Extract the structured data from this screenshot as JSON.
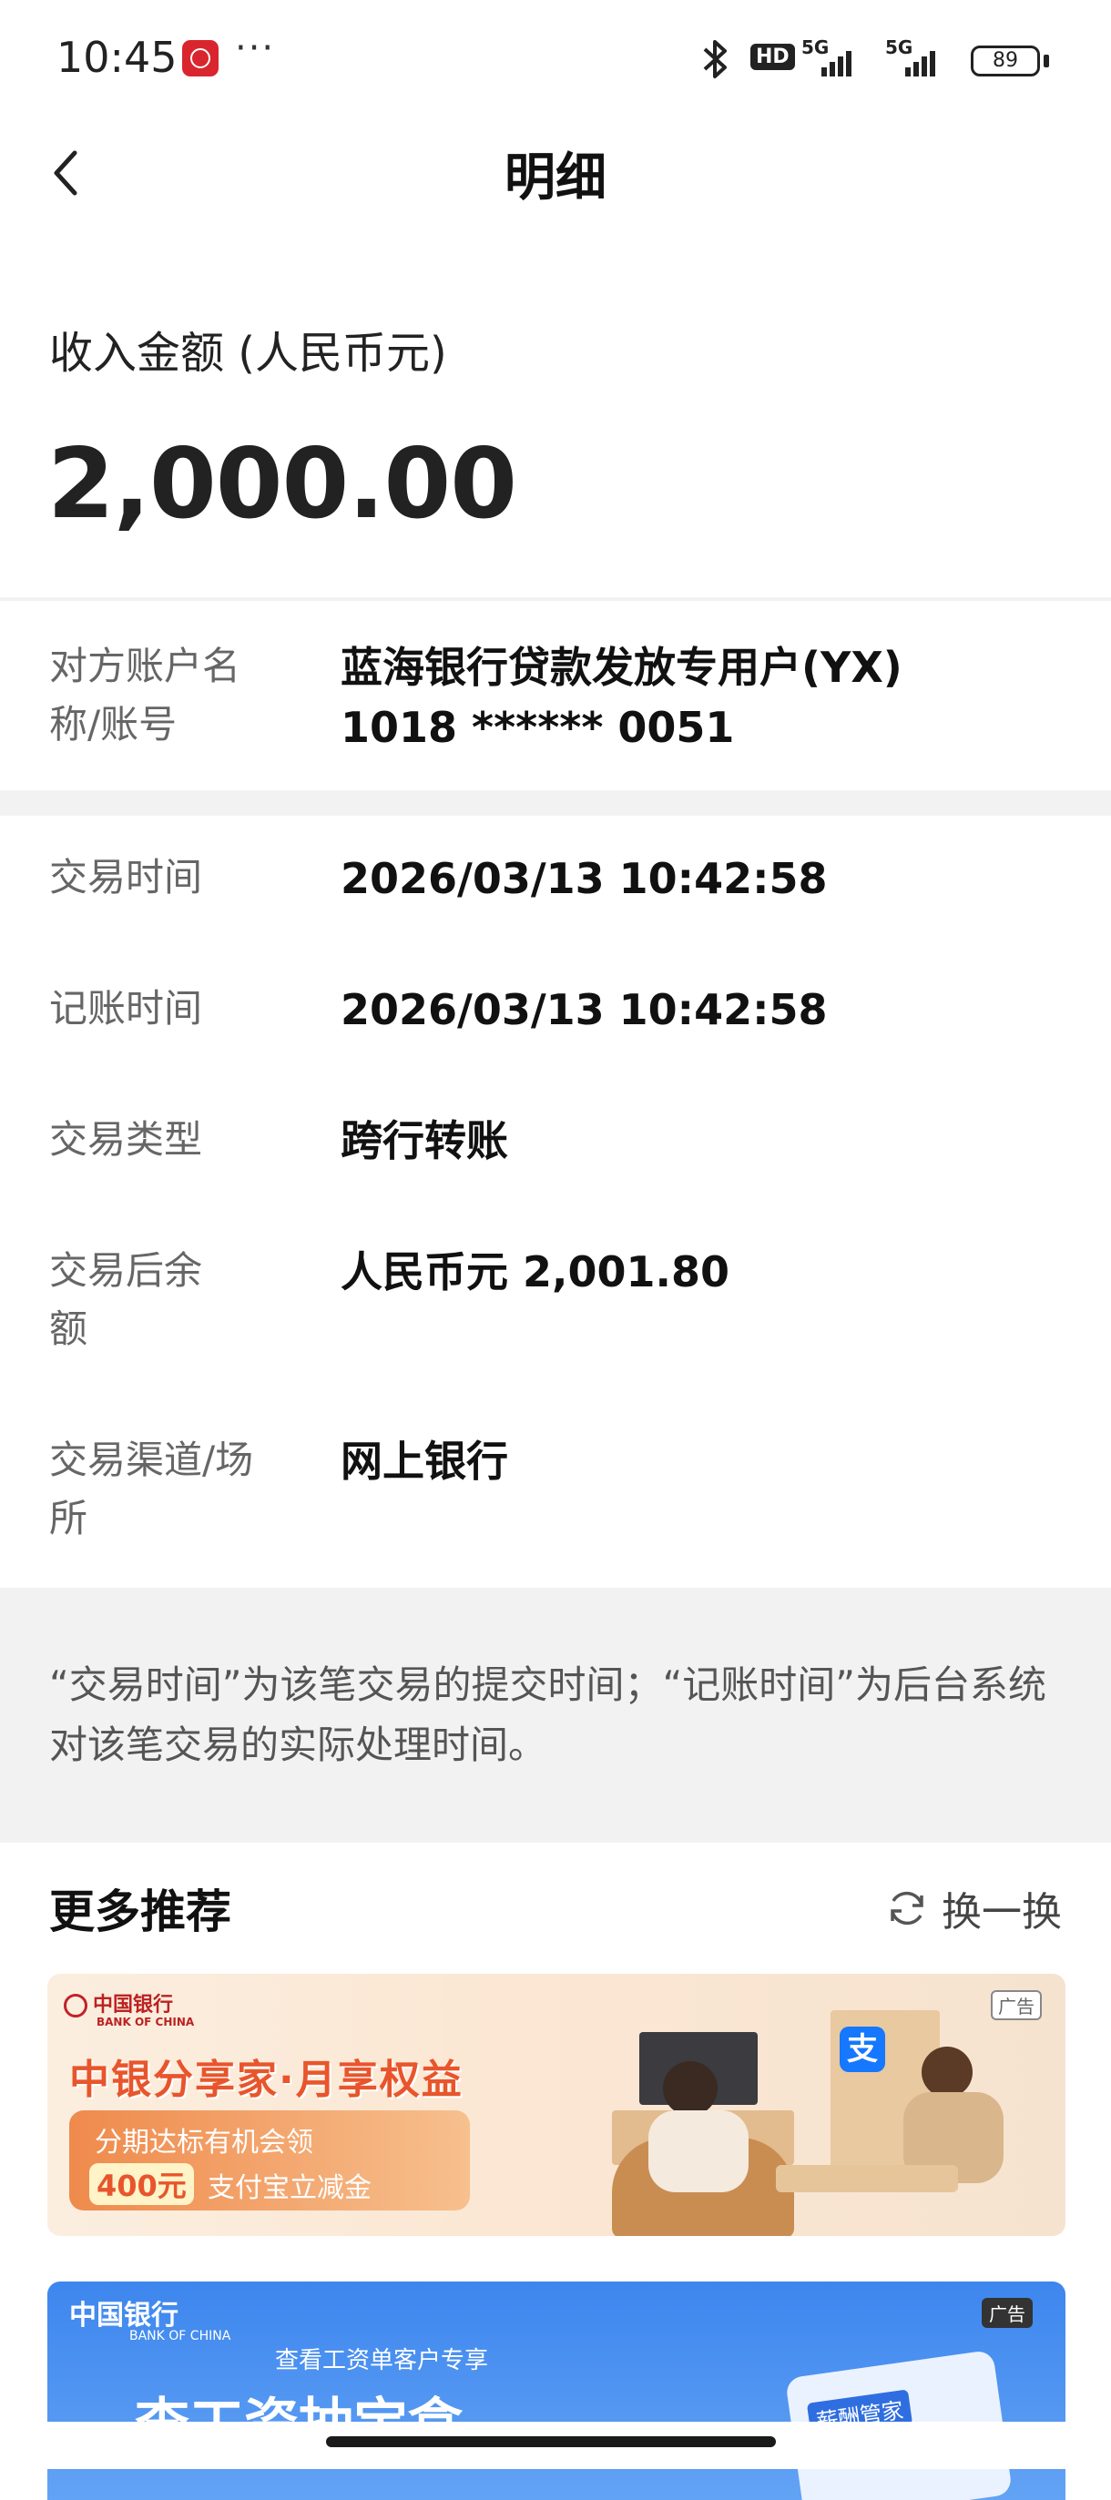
{
  "status_bar": {
    "time": "10:45",
    "more": "···",
    "hd": "HD",
    "signal1": "5G",
    "signal2": "5G",
    "battery": "89"
  },
  "header": {
    "title": "明细"
  },
  "amount": {
    "label": "收入金额 (人民币元)",
    "value": "2,000.00"
  },
  "counterparty": {
    "label": "对方账户名称/账号",
    "value": "蓝海银行贷款发放专用户(YX) 1018 ****** 0051"
  },
  "details": [
    {
      "label": "交易时间",
      "value": "2026/03/13 10:42:58"
    },
    {
      "label": "记账时间",
      "value": "2026/03/13 10:42:58"
    },
    {
      "label": "交易类型",
      "value": "跨行转账"
    },
    {
      "label": "交易后余额",
      "value": "人民币元 2,001.80"
    },
    {
      "label": "交易渠道/场所",
      "value": "网上银行"
    }
  ],
  "notice": "“交易时间”为该笔交易的提交时间；“记账时间”为后台系统对该笔交易的实际处理时间。",
  "more": {
    "title": "更多推荐",
    "refresh_label": "换一换"
  },
  "ads": [
    {
      "logo": "中国银行",
      "logo_en": "BANK OF CHINA",
      "title": "中银分享家·月享权益",
      "line1": "分期达标有机会领",
      "highlight": "400元",
      "line2": "支付宝立减金",
      "tag": "广告",
      "app_badge": "支"
    },
    {
      "logo": "中国银行",
      "logo_en": "BANK OF CHINA",
      "subtitle": "查看工资单客户专享",
      "headline": "查工资抽宝盒",
      "tag": "广告",
      "app_label": "薪酬管家"
    }
  ]
}
